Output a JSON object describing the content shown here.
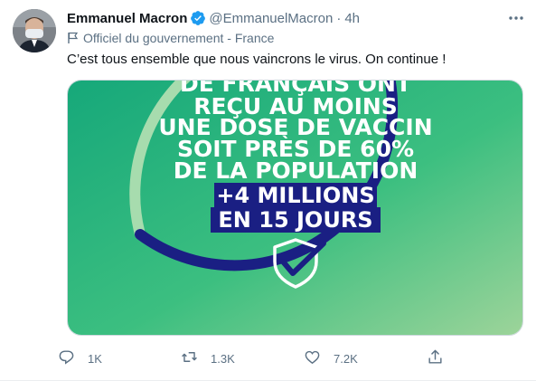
{
  "tweet": {
    "author_name": "Emmanuel Macron",
    "handle": "@EmmanuelMacron",
    "separator": "·",
    "time": "4h",
    "label": "Officiel du gouvernement - France",
    "text": "C’est tous ensemble que nous vaincrons le virus. On continue !"
  },
  "media": {
    "lines": [
      "DE FRANÇAIS ONT",
      "REÇU AU MOINS",
      "UNE DOSE DE VACCIN",
      "SOIT PRÈS DE 60%",
      "DE LA POPULATION"
    ],
    "highlight_lines": [
      "+4 MILLIONS",
      "EN 15 JOURS"
    ],
    "progress_fraction": 0.6,
    "colors": {
      "green": "#1fae7d",
      "navy": "#1a1f83",
      "text": "#ffffff"
    }
  },
  "actions": {
    "reply_count": "1K",
    "retweet_count": "1.3K",
    "like_count": "7.2K"
  },
  "icons": [
    "avatar",
    "verified-badge-icon",
    "more-icon",
    "flag-icon",
    "reply-icon",
    "retweet-icon",
    "like-icon",
    "share-icon",
    "shield-check-icon"
  ]
}
